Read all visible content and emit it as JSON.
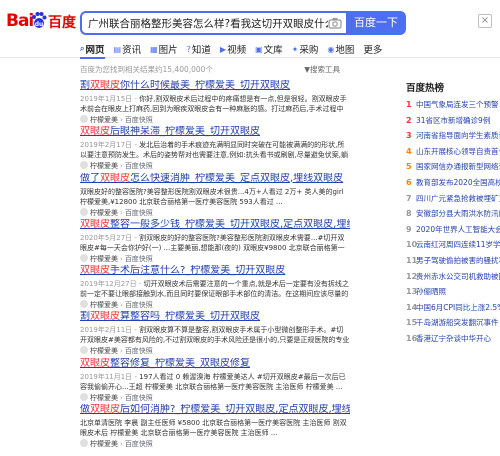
{
  "header": {
    "logo_bai": "Bai",
    "logo_du": "百度",
    "query": "广州联合丽格整形美容怎么样?看我这切开双眼皮什么水平_整容通讯",
    "search_button": "百度一下",
    "close": "×"
  },
  "tabs": [
    {
      "icon": "⌕",
      "label": "网页",
      "active": true
    },
    {
      "icon": "▤",
      "label": "资讯"
    },
    {
      "icon": "▦",
      "label": "图片"
    },
    {
      "icon": "?",
      "label": "知道"
    },
    {
      "icon": "▶",
      "label": "视频"
    },
    {
      "icon": "▣",
      "label": "文库"
    },
    {
      "icon": "✦",
      "label": "采购"
    },
    {
      "icon": "◉",
      "label": "地图"
    },
    {
      "icon": "",
      "label": "更多"
    }
  ],
  "meta": {
    "count": "百度为您找到相关结果约15,400,000个",
    "tools": "▼搜索工具"
  },
  "results": [
    {
      "title_pre": "割",
      "title_hl": "双眼皮",
      "title_post": "你什么时候最美_柠檬爱美_切开双眼皮",
      "date": "2019年1月15日 - ",
      "desc": "你好,割双眼皮术后过程中的疼痛想是有一点,但是很轻。割双眼皮手术前会在眼皮上打麻药,回到为眼疾双眼皮会有一种麻胀的感。打过麻药后,手术过程中感觉不会有...",
      "source": "柠檬爱美",
      "cache": "百度快照"
    },
    {
      "title_pre": "",
      "title_hl": "双眼皮",
      "title_post": "后眼神呆滞_柠檬爱美_切开双眼皮",
      "date": "2019年2月17日 - ",
      "desc": "发北后治着的手术痕迹充满明显同时突破在可能被满满的的形状,所以要注意预防发生。术后的姿势帮对也需要注意,例如:抗头看书或刷剧,尽量避免伏案,躺会加重肿胀。",
      "source": "柠檬爱美",
      "cache": "百度快照"
    },
    {
      "title_pre": "做了",
      "title_hl": "双眼皮",
      "title_post": "怎么快速消肿_柠檬爱美_定点双眼皮,埋线双眼皮",
      "date": "",
      "desc": "双眼皮好的整容医院?美容整形医院割双眼皮术很贵...4万+人看过 2万+ 类人美的girl 柠檬爱美,¥12800 北京联合丽格第一医疗美容医院 593人看过 ...",
      "source": "柠檬爱美",
      "cache": "百度快照"
    },
    {
      "title_pre": "",
      "title_hl": "双眼皮",
      "title_post": "整容一般多少钱_柠檬爱美_切开双眼皮,定点双眼皮,埋线双眼皮",
      "date": "2020年5月27日 - ",
      "desc": "割双眼皮的好的整容医院?美容整形医院割双眼皮术需要...#切开双眼皮#每一天会你护好(一) ...主要美丽,想能那(夜的) 双眼皮¥9800 北京联合丽格第一医疗美容...",
      "source": "柠檬爱美",
      "cache": "百度快照"
    },
    {
      "title_pre": "",
      "title_hl": "双眼皮",
      "title_post": "手术后注意什么?_柠檬爱美_切开双眼皮",
      "date": "2019年12月27日 - ",
      "desc": "切开双眼皮术后需要注意的一个重点,就是术后一定要有没有拆线之前一定不要让眼部接触到水,而且同时要保证眼部手术部位的清洁。在这期间应该尽量的避免吃...",
      "source": "柠檬爱美",
      "cache": "百度快照"
    },
    {
      "title_pre": "割",
      "title_hl": "双眼皮",
      "title_post": "算整容吗_柠檬爱美_切开双眼皮",
      "date": "2019年2月11日 - ",
      "desc": "割双眼皮算不算是整容,割双眼皮手术属于小型微创整形手术。#切开双眼皮#美容都有风险的,不过割双眼皮的手术风险还是很小的,只要是正规医院的专业医师来操作...",
      "source": "柠檬爱美",
      "cache": "百度快照"
    },
    {
      "title_pre": "",
      "title_hl": "双眼皮",
      "title_post": "整容修复_柠檬爱美_双眼皮修复",
      "date": "2019年11月1日 - ",
      "desc": "197人看过 0 赖渥溴海 柠檬爱美达人 #切开双眼皮#最后一次后已容我偷偷开心...王超 柠檬爱美 北京联合丽格第一医疗美容医院 主治医师 柠檬爱美 ...",
      "source": "柠檬爱美",
      "cache": "百度快照"
    },
    {
      "title_pre": "做",
      "title_hl": "双眼皮",
      "title_post": "后如何消肿?_柠檬爱美_切开双眼皮,定点双眼皮,埋线双眼皮",
      "date": "",
      "desc": "北京单清医院 李晨 副主任医师 ¥5800 北京联合丽格第一医疗美容医院 主治医师 割双眼皮术后 柠檬爱美 北京联合丽格第一医疗美容医院 主治医师 ...",
      "source": "柠檬爱美",
      "cache": "百度快照"
    }
  ],
  "hot": {
    "title": "百度热榜",
    "items": [
      {
        "rank": "1",
        "text": "中国气象局连发三个预警"
      },
      {
        "rank": "2",
        "text": "31省区市新增确诊9例"
      },
      {
        "rank": "3",
        "text": "河南省指导面向学生素质讲解"
      },
      {
        "rank": "4",
        "text": "山东开展核心领导自责首长人员"
      },
      {
        "rank": "5",
        "text": "国家网信办通报新型网络诈骗"
      },
      {
        "rank": "6",
        "text": "教育部发布2020全国高校名单"
      },
      {
        "rank": "7",
        "text": "四川广元紧急抢救被埋矿工"
      },
      {
        "rank": "8",
        "text": "安徽部分县大雨洪水防汛应对"
      },
      {
        "rank": "9",
        "text": "2020年世界人工智能大会"
      },
      {
        "rank": "10",
        "text": "云南红河周四连续11岁学童"
      },
      {
        "rank": "11",
        "text": "男子驾驶偷拍被害的骚扰事件"
      },
      {
        "rank": "12",
        "text": "贵州赤水公交司机救助被困者"
      },
      {
        "rank": "13",
        "text": "孙俪晒照"
      },
      {
        "rank": "14",
        "text": "中国6月CPI同比上涨2.5%"
      },
      {
        "rank": "15",
        "text": "千岛湖游船突发翻沉事件"
      },
      {
        "rank": "16",
        "text": "香港辽宁杂谈中华开心"
      }
    ]
  },
  "colors": {
    "brand_red": "#e10602",
    "brand_blue": "#4e6ef2",
    "link": "#2440b3",
    "highlight": "#f73131"
  }
}
